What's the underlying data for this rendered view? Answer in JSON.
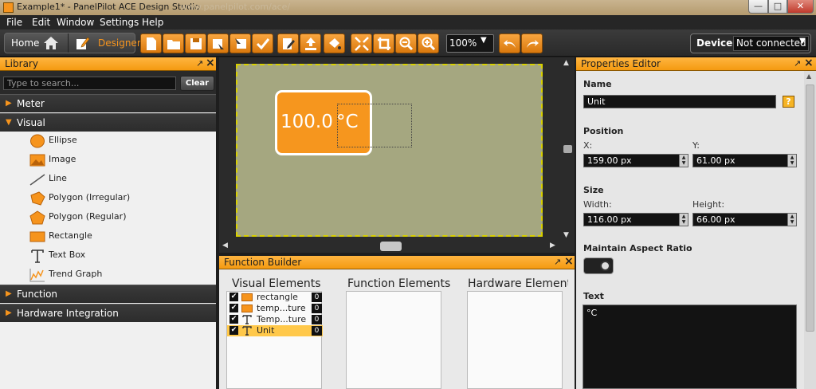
{
  "window": {
    "title": "Example1* - PanelPilot ACE Design Studio",
    "url_ghost": "www.panelpilot.com/ace/",
    "min_label": "—",
    "max_label": "□",
    "close_label": "✕"
  },
  "menu": [
    "File",
    "Edit",
    "Window",
    "Settings",
    "Help"
  ],
  "toolbar": {
    "home_label": "Home",
    "designer_label": "Designer",
    "zoom_value": "100%",
    "device_label": "Device:",
    "device_value": "Not connected",
    "buttons": [
      "new-file",
      "open-folder",
      "save",
      "export-image",
      "import",
      "check",
      "edit-document",
      "upload",
      "paint-bucket",
      "fit-screen",
      "crop",
      "zoom-out",
      "zoom-in",
      "undo",
      "redo"
    ]
  },
  "library": {
    "title": "Library",
    "search_placeholder": "Type to search...",
    "clear_label": "Clear",
    "categories": {
      "meter": "Meter",
      "visual": "Visual",
      "function": "Function",
      "hardware": "Hardware Integration"
    },
    "visual_items": [
      "Ellipse",
      "Image",
      "Line",
      "Polygon (Irregular)",
      "Polygon (Regular)",
      "Rectangle",
      "Text Box",
      "Trend Graph"
    ]
  },
  "canvas": {
    "temperature": "100.0",
    "unit": "°C",
    "surface_color": "#a5a780",
    "element_color": "#f6961e"
  },
  "function_builder": {
    "title": "Function Builder",
    "columns": [
      "Visual Elements",
      "Function Elements",
      "Hardware Elements"
    ],
    "visual_elements": [
      {
        "check": "✔",
        "name": "rectangle",
        "count": "0"
      },
      {
        "check": "✔",
        "name": "temp...ture",
        "count": "0"
      },
      {
        "check": "✔",
        "name": "Temp...ture",
        "count": "0"
      },
      {
        "check": "✔",
        "name": "Unit",
        "count": "0"
      }
    ]
  },
  "properties": {
    "title": "Properties Editor",
    "name_label": "Name",
    "name_value": "Unit",
    "help_label": "?",
    "position_label": "Position",
    "x_label": "X:",
    "x_value": "159.00 px",
    "y_label": "Y:",
    "y_value": "61.00 px",
    "size_label": "Size",
    "width_label": "Width:",
    "width_value": "116.00 px",
    "height_label": "Height:",
    "height_value": "66.00 px",
    "aspect_label": "Maintain Aspect Ratio",
    "text_label": "Text",
    "text_value": "°C"
  },
  "colors": {
    "accent": "#f6941d",
    "panel_header": "#f4a020",
    "dark_bg": "#2b2b2b"
  }
}
